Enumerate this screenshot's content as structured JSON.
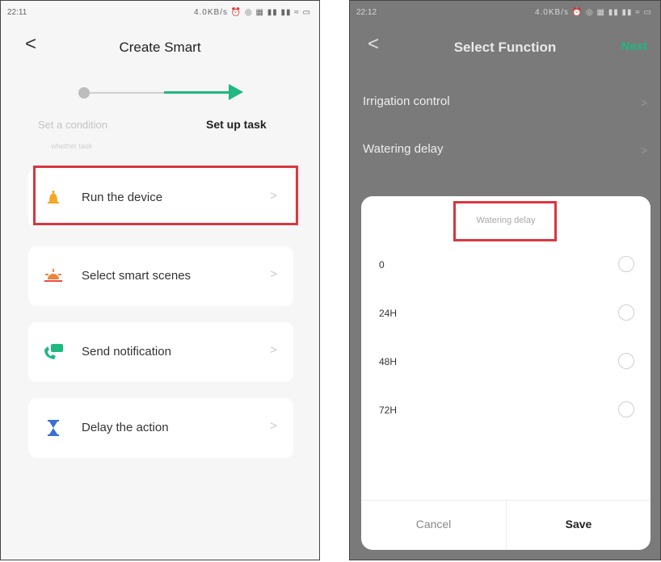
{
  "left": {
    "status_time": "22:11",
    "status_icons": "4.0KB/s ⏰ ◎ ▦ ▮▮ ▮▮ ≈ ▭",
    "title": "Create Smart",
    "back": "<",
    "steps": {
      "step1": "Set a condition",
      "step1_sub": "whether task",
      "step2": "Set up task"
    },
    "tasks": [
      {
        "label": "Run the device",
        "chevron": ">"
      },
      {
        "label": "Select smart scenes",
        "chevron": ">"
      },
      {
        "label": "Send notification",
        "chevron": ">"
      },
      {
        "label": "Delay the action",
        "chevron": ">"
      }
    ],
    "colors": {
      "accent": "#1fb880",
      "highlight": "#d9363e"
    }
  },
  "right": {
    "status_time": "22:12",
    "status_icons": "4.0KB/s ⏰ ◎ ▦ ▮▮ ▮▮ ≈ ▭",
    "title": "Select Function",
    "back": "<",
    "next": "Next",
    "functions": [
      {
        "label": "Irrigation control",
        "chevron": ">"
      },
      {
        "label": "Watering delay",
        "chevron": ">"
      }
    ],
    "sheet": {
      "title": "Watering delay",
      "options": [
        "0",
        "24H",
        "48H",
        "72H"
      ],
      "cancel": "Cancel",
      "save": "Save"
    }
  }
}
